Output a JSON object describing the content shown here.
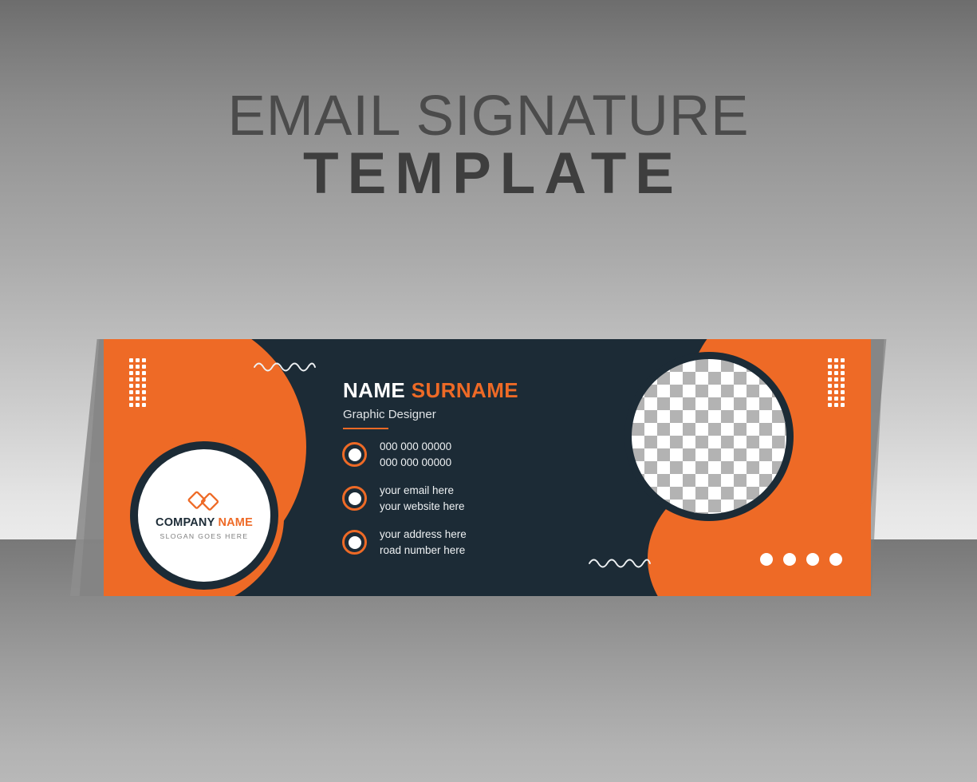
{
  "heading": {
    "line1": "EMAIL SIGNATURE",
    "line2": "TEMPLATE"
  },
  "colors": {
    "orange": "#ee6a26",
    "dark_navy": "#1c2b36",
    "white": "#ffffff",
    "slogan_gray": "#7d7d7d",
    "heading_gray": "#4b4b4b"
  },
  "card": {
    "logo": {
      "mark_icon": "overlapping-diamonds-icon",
      "company_primary": "COMPANY",
      "company_accent": "NAME",
      "slogan": "SLOGAN GOES HERE"
    },
    "identity": {
      "first_name": "NAME",
      "last_name": "SURNAME",
      "role": "Graphic Designer"
    },
    "contacts": [
      {
        "icon": "phone-icon",
        "line1": "000 000 00000",
        "line2": "000 000 00000"
      },
      {
        "icon": "email-icon",
        "line1": "your email here",
        "line2": "your website here"
      },
      {
        "icon": "location-icon",
        "line1": "your address here",
        "line2": "road number here"
      }
    ],
    "photo": {
      "label": "photo-placeholder",
      "state": "transparent-checkerboard"
    },
    "decorations": {
      "dot_grid_columns": 3,
      "dot_grid_rows": 8,
      "wave_cycles": 4,
      "bottom_dot_count": 4
    }
  }
}
